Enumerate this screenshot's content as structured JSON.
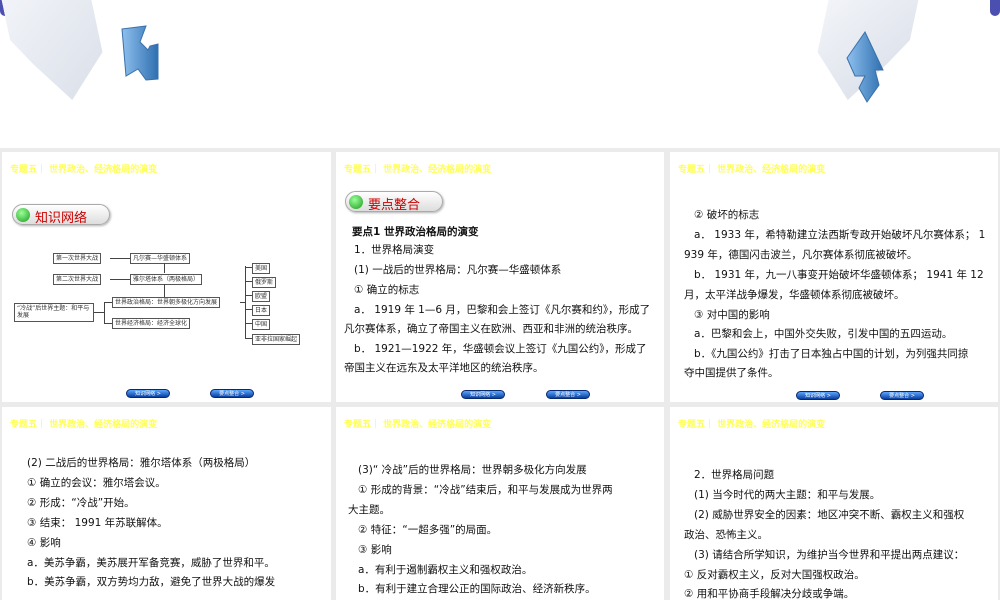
{
  "header": "专题五｜ 世界政治、经济格局的演变",
  "nav": {
    "knowledge": "知识网络 >",
    "key_points": "要点整合 >"
  },
  "slide1": {
    "pill": "知识网络",
    "diagram": {
      "ww1": "第一次世界大战",
      "vw": "凡尔赛—华盛顿体系",
      "ww2": "第二次世界大战",
      "yalta": "雅尔塔体系（两极格局）",
      "postcold": "“冷战”后世界主题：和平与发展",
      "politics": "世界政治格局：世界朝多极化方向发展",
      "economy": "世界经济格局：经济全球化",
      "poles": [
        "美国",
        "俄罗斯",
        "欧盟",
        "日本",
        "中国",
        "亚非拉国家崛起"
      ]
    }
  },
  "slide2": {
    "pill": "要点整合",
    "lines": [
      "要点1  世界政治格局的演变",
      "1．世界格局演变",
      "(1) 一战后的世界格局：凡尔赛—华盛顿体系",
      "① 确立的标志",
      "a． 1919 年 1—6 月，巴黎和会上签订《凡尔赛和约》，形成了",
      "凡尔赛体系，确立了帝国主义在欧洲、西亚和非洲的统治秩序。",
      "b． 1921—1922 年，华盛顿会议上签订《九国公约》，形成了",
      "帝国主义在远东及太平洋地区的统治秩序。"
    ]
  },
  "slide3": {
    "lines": [
      "② 破坏的标志",
      "a． 1933 年，希特勒建立法西斯专政开始破坏凡尔赛体系； 1",
      "939 年，德国闪击波兰，凡尔赛体系彻底被破坏。",
      "b． 1931 年，九一八事变开始破坏华盛顿体系； 1941 年 12",
      "月，太平洋战争爆发，华盛顿体系彻底被破坏。",
      "③ 对中国的影响",
      "a．巴黎和会上，中国外交失败，引发中国的五四运动。",
      "b．《九国公约》打击了日本独占中国的计划，为列强共同掠",
      "夺中国提供了条件。"
    ]
  },
  "slide4": {
    "lines": [
      "(2) 二战后的世界格局：雅尔塔体系（两极格局）",
      "① 确立的会议：雅尔塔会议。",
      "② 形成：“冷战”开始。",
      "③ 结束： 1991 年苏联解体。",
      "④ 影响",
      "a．美苏争霸，美苏展开军备竞赛，威胁了世界和平。",
      "b．美苏争霸，双方势均力敌，避免了世界大战的爆发"
    ]
  },
  "slide5": {
    "lines": [
      "(3)“ 冷战”后的世界格局：世界朝多极化方向发展",
      "① 形成的背景：“冷战”结束后，和平与发展成为世界两",
      "大主题。",
      "② 特征：“一超多强”的局面。",
      "③ 影响",
      "a．有利于遏制霸权主义和强权政治。",
      "b．有利于建立合理公正的国际政治、经济新秩序。"
    ]
  },
  "slide6": {
    "lines": [
      "2．世界格局问题",
      "(1) 当今时代的两大主题：和平与发展。",
      "(2) 威胁世界安全的因素：地区冲突不断、霸权主义和强权",
      "政治、恐怖主义。",
      "(3) 请结合所学知识，为维护当今世界和平提出两点建议：",
      "① 反对霸权主义，反对大国强权政治。",
      "② 用和平协商手段解决分歧或争端。"
    ]
  }
}
